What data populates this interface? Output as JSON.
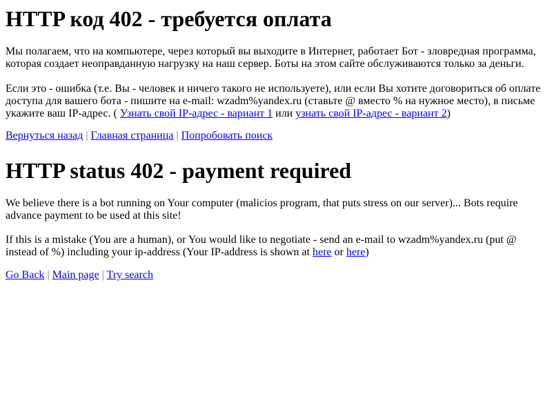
{
  "ru": {
    "title": "HTTP код 402 - требуется оплата",
    "paragraph1": "Мы полагаем, что на компьютере, через который вы выходите в Интернет, работает Бот - зловредная программа, которая создает неоправданную нагрузку на наш сервер. Боты на этом сайте обслуживаются только за деньги.",
    "paragraph2_text": "Если это - ошибка (т.е. Вы - человек и ничего такого не используете), или если Вы хотите договориться об оплате доступа для вашего бота - пишите на e-mail: wzadm%yandex.ru (ставьте @ вместо % на нужное место), в письме укажите ваш IP-адрес. (",
    "ip_link_1": "Узнать свой IP-адрес - вариант 1",
    "or_text": "или",
    "ip_link_2": "узнать свой IP-адрес - вариант 2",
    "paragraph2_end": ")",
    "nav": {
      "back": "Вернуться назад",
      "home": "Главная страница",
      "search": "Попробовать поиск",
      "separator": "|"
    }
  },
  "en": {
    "title": "HTTP status 402 - payment required",
    "paragraph1": "We believe there is a bot running on Your computer (malicios program, that puts stress on our server)... Bots require advance payment to be used at this site!",
    "paragraph2_text": "If this is a mistake (You are a human), or You would like to negotiate - send an e-mail to wzadm%yandex.ru (put @ instead of %) including your ip-address (Your IP-address is shown at",
    "here_link_1": "here",
    "or_text": "or",
    "here_link_2": "here",
    "paragraph2_end": ")",
    "nav": {
      "back": "Go Back",
      "home": "Main page",
      "search": "Try search",
      "separator": "|"
    }
  },
  "colors": {
    "link": "#0000ee",
    "text": "#000000",
    "separator": "#777777",
    "background": "#ffffff"
  }
}
